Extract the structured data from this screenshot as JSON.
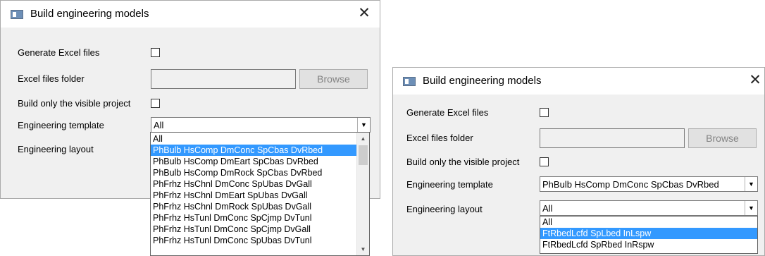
{
  "dialog1": {
    "title": "Build engineering models",
    "close_glyph": "✕",
    "generate_excel_label": "Generate Excel files",
    "excel_folder_label": "Excel files folder",
    "excel_folder_value": "",
    "browse_label": "Browse",
    "visible_project_label": "Build only the visible project",
    "template_label": "Engineering template",
    "template_value": "All",
    "layout_label": "Engineering layout",
    "template_options": [
      "All",
      "PhBulb HsComp DmConc SpCbas DvRbed",
      "PhBulb HsComp DmEart SpCbas DvRbed",
      "PhBulb HsComp DmRock SpCbas DvRbed",
      "PhFrhz HsChnl DmConc SpUbas DvGall",
      "PhFrhz HsChnl DmEart SpUbas DvGall",
      "PhFrhz HsChnl DmRock SpUbas DvGall",
      "PhFrhz HsTunl DmConc SpCjmp DvTunl",
      "PhFrhz HsTunl DmConc SpCjmp DvGall",
      "PhFrhz HsTunl DmConc SpUbas DvTunl"
    ],
    "selected_option": "PhBulb HsComp DmConc SpCbas DvRbed"
  },
  "dialog2": {
    "title": "Build engineering models",
    "close_glyph": "✕",
    "generate_excel_label": "Generate Excel files",
    "excel_folder_label": "Excel files folder",
    "excel_folder_value": "",
    "browse_label": "Browse",
    "visible_project_label": "Build only the visible project",
    "template_label": "Engineering template",
    "template_value": "PhBulb HsComp DmConc SpCbas DvRbed",
    "layout_label": "Engineering layout",
    "layout_value": "All",
    "layout_options": [
      "All",
      "FtRbedLcfd SpLbed InLspw",
      "FtRbedLcfd SpRbed InRspw"
    ],
    "selected_option": "FtRbedLcfd SpLbed InLspw"
  },
  "colors": {
    "dialog_bg": "#f0f0f0",
    "selection": "#3399ff",
    "titlebar": "#ffffff"
  },
  "icons": {
    "app": "window-app-icon",
    "close": "close-icon",
    "combo_arrow": "chevron-down-icon",
    "scroll_up": "scroll-up-icon",
    "scroll_down": "scroll-down-icon"
  }
}
